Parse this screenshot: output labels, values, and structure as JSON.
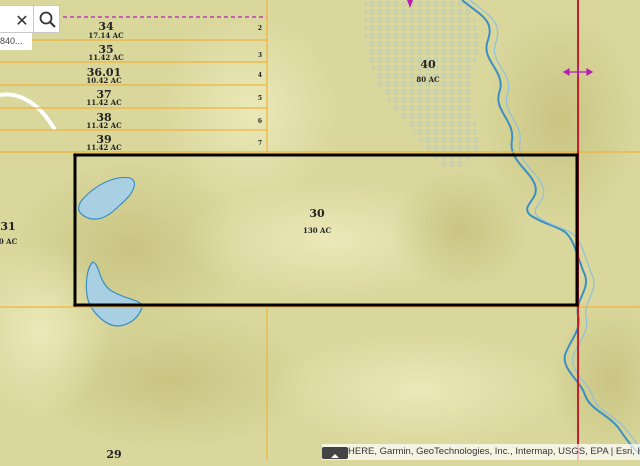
{
  "search": {
    "input_value": "840...",
    "clear_icon": "close-icon",
    "search_icon": "search-icon"
  },
  "parcels": {
    "row_numbers": [
      "2",
      "3",
      "4",
      "5",
      "6",
      "7"
    ],
    "p34": {
      "id": "34",
      "acres": "17.14 AC"
    },
    "p35": {
      "id": "35",
      "acres": "11.42 AC"
    },
    "p36": {
      "id": "36.01",
      "acres": "10.42 AC"
    },
    "p37": {
      "id": "37",
      "acres": "11.42 AC"
    },
    "p38": {
      "id": "38",
      "acres": "11.42 AC"
    },
    "p39": {
      "id": "39",
      "acres": "11.42 AC"
    },
    "p40": {
      "id": "40",
      "acres": "80 AC"
    },
    "p30": {
      "id": "30",
      "acres": "130 AC"
    },
    "p31": {
      "id": "31",
      "acres": "0 AC"
    },
    "p29": {
      "id": "29"
    }
  },
  "attribution": "HERE, Garmin, GeoTechnologies, Inc., Intermap, USGS, EPA | Esri, H",
  "colors": {
    "terrain": "#d9d79c",
    "parcel_line": "#f0b43c",
    "highlight": "#000000",
    "water": "#a9cfe3",
    "water_edge": "#3a8fc4",
    "road": "#c81e2e",
    "marker": "#b41eb4"
  }
}
